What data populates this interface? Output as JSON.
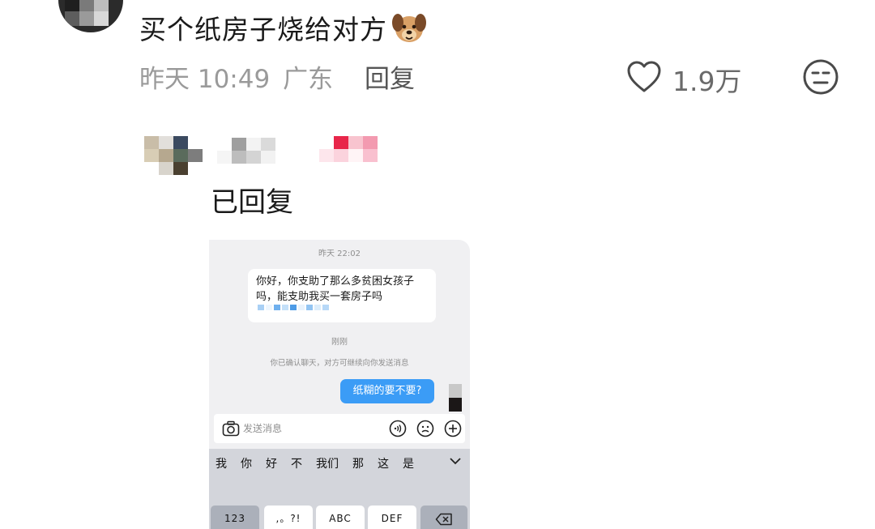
{
  "comment": {
    "text": "买个纸房子烧给对方",
    "emoji": "dog-face-emoji",
    "time": "昨天 10:49",
    "location": "广东",
    "reply_label": "回复",
    "like_count": "1.9万"
  },
  "reply": {
    "text": "已回复"
  },
  "chat": {
    "timestamp_1": "昨天 22:02",
    "incoming_line_1": "你好，你支助了那么多贫困女孩子",
    "incoming_line_2": "吗，能支助我买一套房子吗",
    "timestamp_2": "刚刚",
    "system_note": "你已确认聊天，对方可继续向你发送消息",
    "outgoing_message": "纸糊的要不要?",
    "input_placeholder": "发送消息",
    "keyboard": {
      "candidates": [
        "我",
        "你",
        "好",
        "不",
        "我们",
        "那",
        "这",
        "是"
      ],
      "keys": [
        "123",
        ",。?!",
        "ABC",
        "DEF"
      ]
    }
  },
  "colors": {
    "outgoing_bubble": "#3b9cf6",
    "meta_gray": "#9a9a9a",
    "chat_background": "#f0f0f2",
    "keyboard_background": "#d3d5db"
  }
}
